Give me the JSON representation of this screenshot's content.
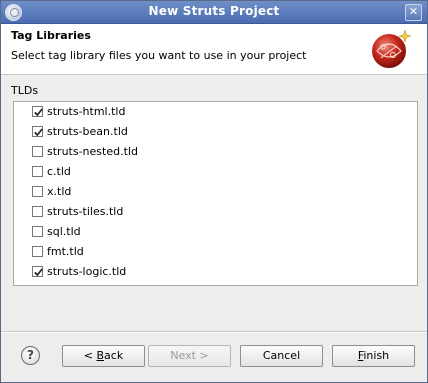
{
  "window": {
    "title": "New Struts Project"
  },
  "header": {
    "title": "Tag Libraries",
    "description": "Select tag library files you want to use in your project"
  },
  "tlds": {
    "label": "TLDs",
    "items": [
      {
        "label": "struts-html.tld",
        "checked": true
      },
      {
        "label": "struts-bean.tld",
        "checked": true
      },
      {
        "label": "struts-nested.tld",
        "checked": false
      },
      {
        "label": "c.tld",
        "checked": false
      },
      {
        "label": "x.tld",
        "checked": false
      },
      {
        "label": "struts-tiles.tld",
        "checked": false
      },
      {
        "label": "sql.tld",
        "checked": false
      },
      {
        "label": "fmt.tld",
        "checked": false
      },
      {
        "label": "struts-logic.tld",
        "checked": true
      }
    ]
  },
  "footer": {
    "help_glyph": "?",
    "back": {
      "prefix": "< ",
      "mnemonic": "B",
      "rest": "ack",
      "enabled": true
    },
    "next": {
      "label": "Next >",
      "enabled": false
    },
    "cancel": {
      "label": "Cancel",
      "enabled": true
    },
    "finish": {
      "mnemonic": "F",
      "rest": "inish",
      "enabled": true
    }
  },
  "icons": {
    "close": "close-icon",
    "app": "eclipse-icon",
    "wizard": "struts-logo-icon",
    "help": "help-icon",
    "check": "checkmark-icon"
  }
}
